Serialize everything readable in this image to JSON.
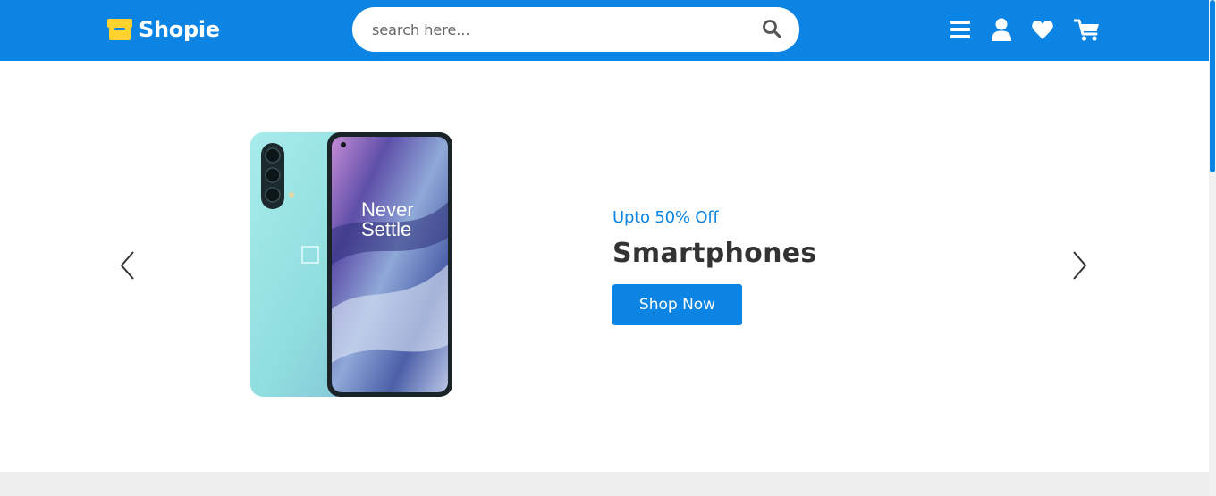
{
  "brand": {
    "name": "Shopie",
    "accent_color": "#0b84e3",
    "logo_icon": "store-icon"
  },
  "search": {
    "placeholder": "search here...",
    "value": "",
    "icon": "search-icon"
  },
  "header_icons": [
    "menu-icon",
    "user-icon",
    "heart-icon",
    "cart-icon"
  ],
  "slider": {
    "prev_icon": "chevron-left-icon",
    "next_icon": "chevron-right-icon",
    "active_slide": {
      "discount": "Upto 50% Off",
      "title": "Smartphones",
      "button_label": "Shop Now",
      "image": "smartphone-image",
      "image_screen_text": "Never Settle"
    }
  }
}
